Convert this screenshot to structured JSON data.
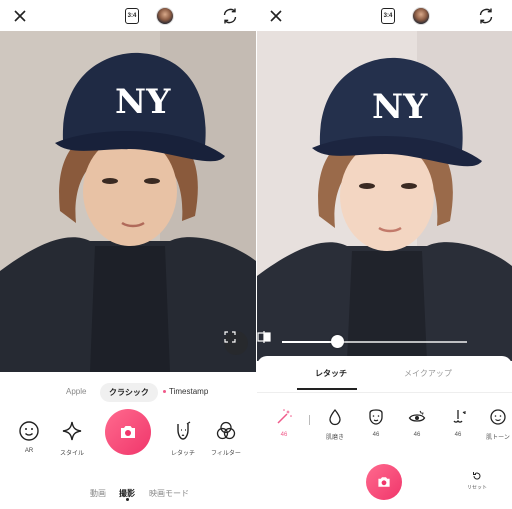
{
  "left": {
    "topbar": {
      "ratio": "3:4"
    },
    "modes": {
      "apple": "Apple",
      "classic": "クラシック",
      "timestamp": "Timestamp"
    },
    "tools": {
      "ar": "AR",
      "style": "スタイル",
      "retouch": "レタッチ",
      "filter": "フィルター"
    },
    "bottom_tabs": {
      "video": "動画",
      "photo": "撮影",
      "movie_mode": "映画モード"
    }
  },
  "right": {
    "topbar": {
      "ratio": "3:4"
    },
    "slider": {
      "value": 0.3
    },
    "sheet_tabs": {
      "retouch": "レタッチ",
      "makeup": "メイクアップ"
    },
    "retouch_items": [
      {
        "label": "",
        "value": "46",
        "icon": "magic-wand-icon"
      },
      {
        "label": "肌磨き",
        "value": "46",
        "icon": "drop-icon"
      },
      {
        "label": "",
        "value": "46",
        "icon": "face-icon"
      },
      {
        "label": "",
        "value": "46",
        "icon": "eye-icon"
      },
      {
        "label": "",
        "value": "46",
        "icon": "nose-icon"
      },
      {
        "label": "肌トーン",
        "value": "",
        "icon": "skin-tone-icon"
      }
    ],
    "reset_label": "リセット"
  },
  "colors": {
    "accent": "#f0366b",
    "accent_light": "#ff6a8e"
  }
}
